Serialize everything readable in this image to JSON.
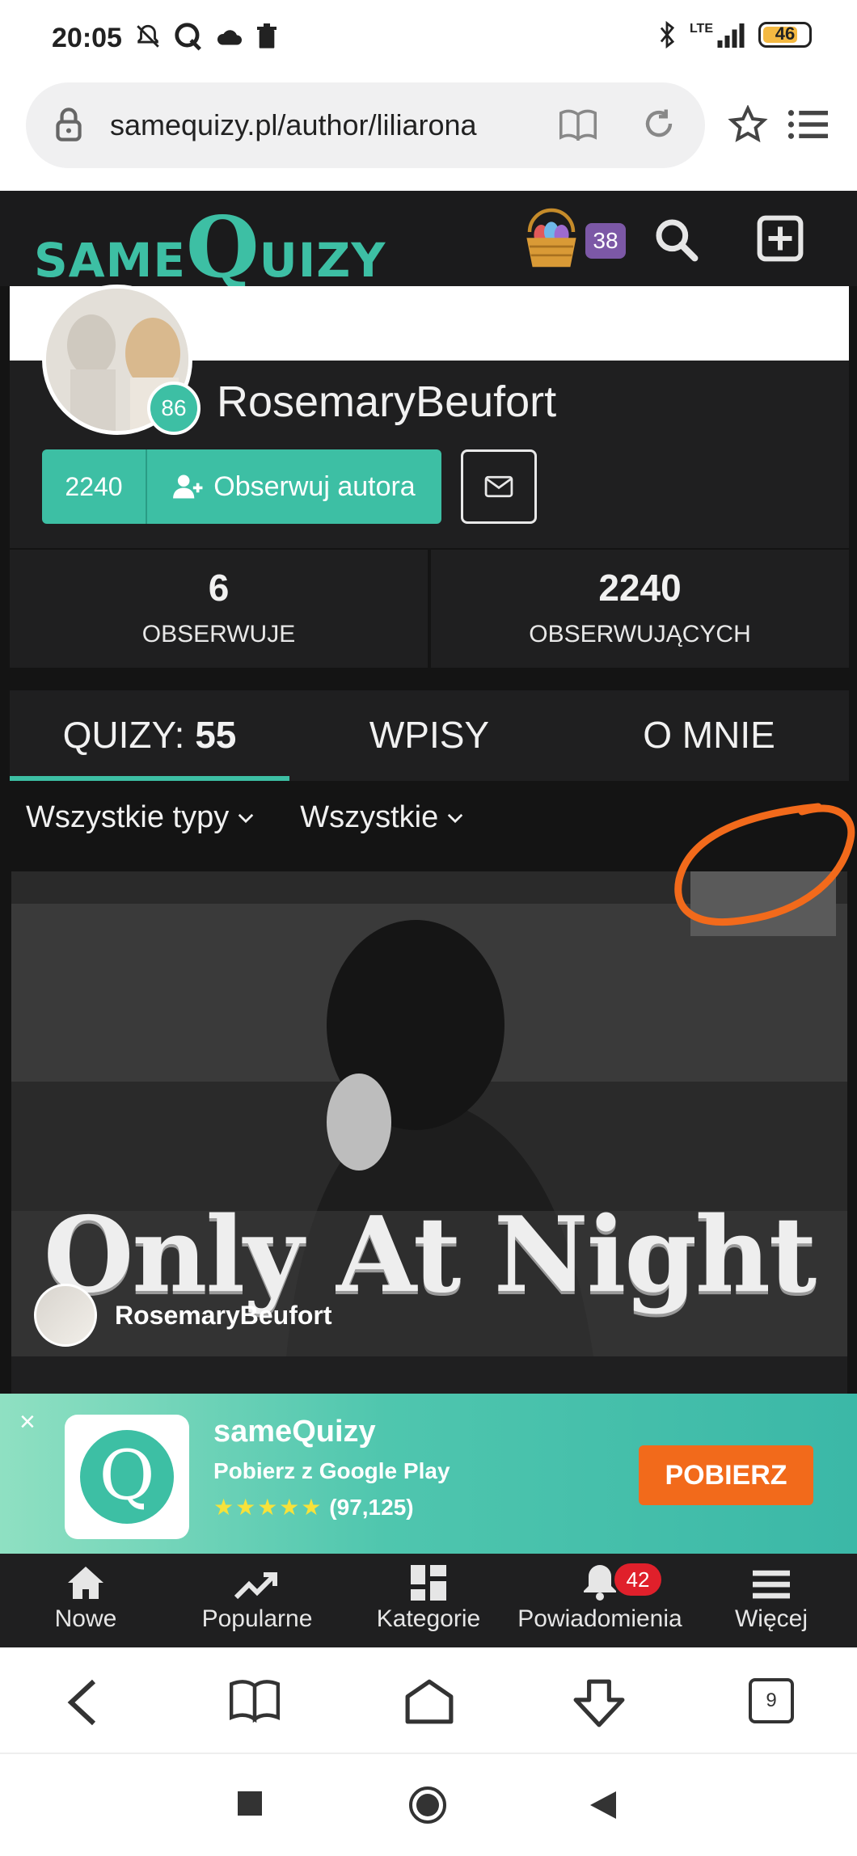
{
  "status_bar": {
    "time": "20:05",
    "network": "LTE",
    "battery": "46"
  },
  "browser": {
    "url": "samequizy.pl/author/liliarona",
    "tab_count": "9"
  },
  "site_header": {
    "logo_prefix": "SAME",
    "logo_q": "Q",
    "logo_suffix": "UIZY",
    "basket_count": "38"
  },
  "profile": {
    "level": "86",
    "username": "RosemaryBeufort",
    "follower_count_button": "2240",
    "follow_label": "Obserwuj autora",
    "stats": [
      {
        "value": "6",
        "label": "OBSERWUJE"
      },
      {
        "value": "2240",
        "label": "OBSERWUJĄCYCH"
      }
    ]
  },
  "tabs": [
    {
      "label": "QUIZY: ",
      "count": "55",
      "active": true
    },
    {
      "label": "WPISY",
      "active": false
    },
    {
      "label": "O MNIE",
      "active": false
    }
  ],
  "filters": {
    "type": "Wszystkie typy",
    "scope": "Wszystkie"
  },
  "quiz_card": {
    "cover_title": "Only At Night",
    "author": "RosemaryBeufort"
  },
  "app_banner": {
    "close": "×",
    "name": "sameQuizy",
    "subtitle": "Pobierz z Google Play",
    "stars": "★★★★★",
    "reviews": "(97,125)",
    "button": "POBIERZ"
  },
  "site_nav": [
    {
      "label": "Nowe",
      "icon": "home-icon"
    },
    {
      "label": "Popularne",
      "icon": "trending-icon"
    },
    {
      "label": "Kategorie",
      "icon": "grid-icon"
    },
    {
      "label": "Powiadomienia",
      "icon": "bell-icon",
      "badge": "42"
    },
    {
      "label": "Więcej",
      "icon": "hamburger-icon"
    }
  ],
  "colors": {
    "accent": "#3dbfa4",
    "header_bg": "#1b1b1c",
    "panel_bg": "#1f1f20",
    "cta": "#f26a1b",
    "annotation": "#f26a1b"
  }
}
